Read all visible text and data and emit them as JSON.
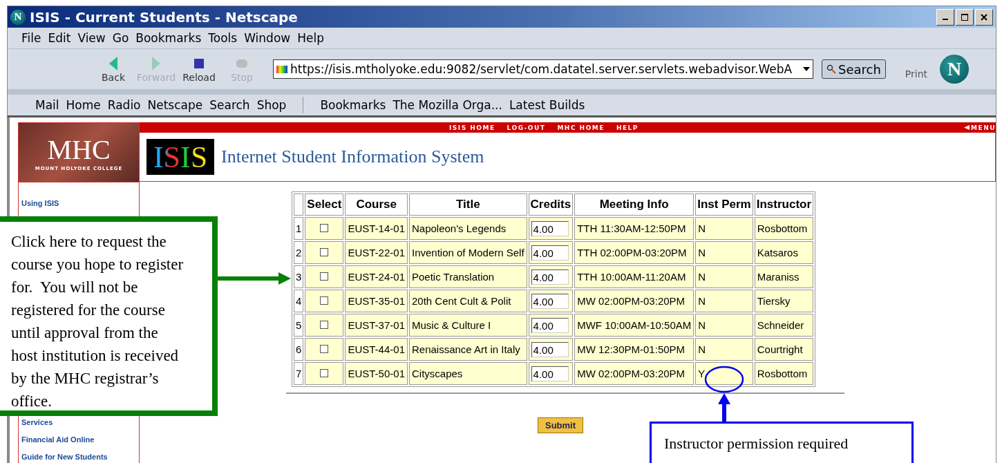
{
  "window": {
    "title": "ISIS - Current Students - Netscape",
    "logo_letter": "N"
  },
  "menu": [
    "File",
    "Edit",
    "View",
    "Go",
    "Bookmarks",
    "Tools",
    "Window",
    "Help"
  ],
  "toolbar": [
    {
      "label": "Back",
      "disabled": false
    },
    {
      "label": "Forward",
      "disabled": true
    },
    {
      "label": "Reload",
      "disabled": false
    },
    {
      "label": "Stop",
      "disabled": true
    }
  ],
  "address": {
    "value": "https://isis.mtholyoke.edu:9082/servlet/com.datatel.server.servlets.webadvisor.WebA"
  },
  "search_button": "Search",
  "throbber_letter": "N",
  "print_button": "Print",
  "personal_bar": [
    "Mail",
    "Home",
    "Radio",
    "Netscape",
    "Search",
    "Shop"
  ],
  "bookmarks_bar": [
    "Bookmarks",
    "The Mozilla Orga...",
    "Latest Builds"
  ],
  "site": {
    "nav": [
      "ISIS HOME",
      "LOG-OUT",
      "MHC HOME",
      "HELP"
    ],
    "menu": "MENU",
    "logo_text": "MHC",
    "logo_sub": "MOUNT HOLYOKE COLLEGE",
    "isis_logo": "ISIS",
    "heading": "Internet Student Information System"
  },
  "sidebar": {
    "items": [
      "Using ISIS",
      "Services",
      "Financial Aid Online",
      "Guide for New Students"
    ]
  },
  "table": {
    "columns": [
      "Select",
      "Course",
      "Title",
      "Credits",
      "Meeting Info",
      "Inst Perm",
      "Instructor"
    ],
    "rows": [
      {
        "n": "1",
        "checked": false,
        "course": "EUST-14-01",
        "title": "Napoleon's Legends",
        "credits": "4.00",
        "meeting": "TTH 11:30AM-12:50PM",
        "perm": "N",
        "instructor": "Rosbottom"
      },
      {
        "n": "2",
        "checked": false,
        "course": "EUST-22-01",
        "title": "Invention of Modern Self",
        "credits": "4.00",
        "meeting": "TTH 02:00PM-03:20PM",
        "perm": "N",
        "instructor": "Katsaros"
      },
      {
        "n": "3",
        "checked": false,
        "course": "EUST-24-01",
        "title": "Poetic Translation",
        "credits": "4.00",
        "meeting": "TTH 10:00AM-11:20AM",
        "perm": "N",
        "instructor": "Maraniss"
      },
      {
        "n": "4",
        "checked": false,
        "course": "EUST-35-01",
        "title": "20th Cent Cult & Polit",
        "credits": "4.00",
        "meeting": "MW 02:00PM-03:20PM",
        "perm": "N",
        "instructor": "Tiersky"
      },
      {
        "n": "5",
        "checked": false,
        "course": "EUST-37-01",
        "title": "Music & Culture I",
        "credits": "4.00",
        "meeting": "MWF 10:00AM-10:50AM",
        "perm": "N",
        "instructor": "Schneider"
      },
      {
        "n": "6",
        "checked": false,
        "course": "EUST-44-01",
        "title": "Renaissance Art in Italy",
        "credits": "4.00",
        "meeting": "MW 12:30PM-01:50PM",
        "perm": "N",
        "instructor": "Courtright"
      },
      {
        "n": "7",
        "checked": false,
        "course": "EUST-50-01",
        "title": "Cityscapes",
        "credits": "4.00",
        "meeting": "MW 02:00PM-03:20PM",
        "perm": "Y",
        "instructor": "Rosbottom"
      }
    ]
  },
  "submit_button": "Submit",
  "callouts": [
    {
      "kind": "green",
      "text": "Click here to request the course you hope to register for.  You will not be registered for the course until approval from the host institution is received by the MHC registrar’s office."
    },
    {
      "kind": "blue",
      "text": "Instructor permission required"
    }
  ]
}
